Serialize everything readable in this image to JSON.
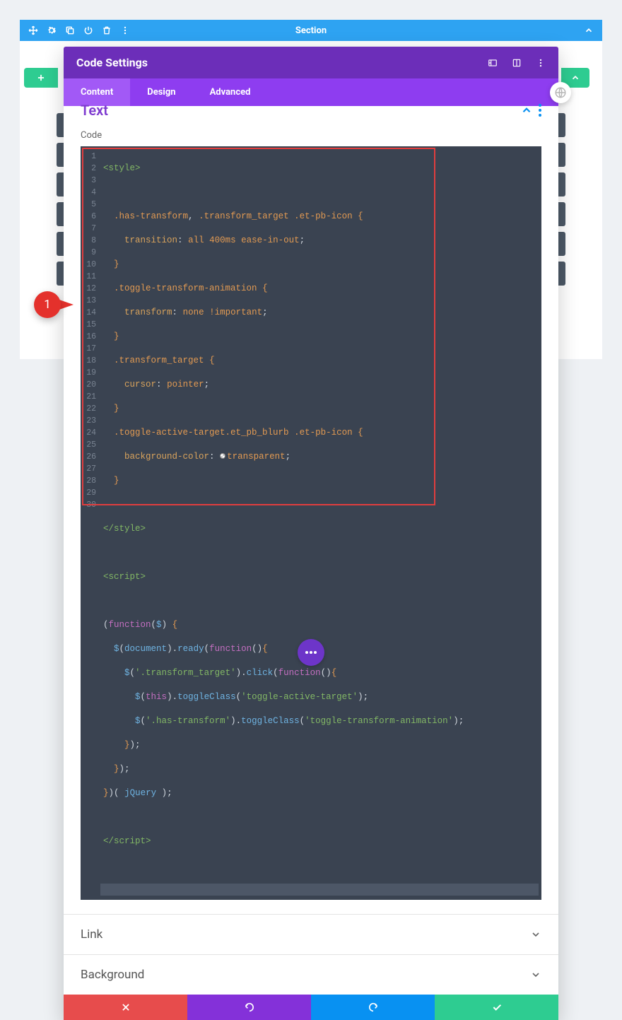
{
  "section": {
    "title": "Section"
  },
  "modal": {
    "title": "Code Settings",
    "tabs": {
      "content": "Content",
      "design": "Design",
      "advanced": "Advanced"
    },
    "text_section": "Text",
    "code_label": "Code",
    "accordion": {
      "link": "Link",
      "background": "Background"
    }
  },
  "annotation": {
    "number": "1"
  },
  "code": {
    "lines": [
      "<style>",
      "",
      "  .has-transform, .transform_target .et-pb-icon {",
      "    transition: all 400ms ease-in-out;",
      "  }",
      "  .toggle-transform-animation {",
      "    transform: none !important;",
      "  }",
      "  .transform_target {",
      "    cursor: pointer;",
      "  }",
      "  .toggle-active-target.et_pb_blurb .et-pb-icon {",
      "    background-color: transparent;",
      "  }",
      "",
      "</style>",
      "",
      "<script>",
      "",
      "(function($) {",
      "  $(document).ready(function(){",
      "    $('.transform_target').click(function(){",
      "      $(this).toggleClass('toggle-active-target');",
      "      $('.has-transform').toggleClass('toggle-transform-animation');",
      "    });",
      "  });",
      "})( jQuery );",
      "",
      "</script>",
      ""
    ]
  },
  "tokens": {
    "style_open": "<style>",
    "style_close": "</style>",
    "script_open": "<script>",
    "script_close": "</script>",
    "l3_sel": ".has-transform",
    "l3_sel2": ".transform_target",
    "l3_sel3": ".et-pb-icon",
    "l4_prop": "transition",
    "l4_all": "all",
    "l4_dur": "400ms",
    "l4_ease": "ease-in-out",
    "l6_sel": ".toggle-transform-animation",
    "l7_prop": "transform",
    "l7_val": "none",
    "l7_imp": "!important",
    "l9_sel": ".transform_target",
    "l10_prop": "cursor",
    "l10_val": "pointer",
    "l12_sel": ".toggle-active-target.et_pb_blurb",
    "l12_sel2": ".et-pb-icon",
    "l13_prop": "background-color",
    "l13_val": "transparent",
    "fn": "function",
    "dollar": "$",
    "doc": "document",
    "ready": "ready",
    "click": "click",
    "this": "this",
    "toggleClass": "toggleClass",
    "str1": "'.transform_target'",
    "str2": "'toggle-active-target'",
    "str3": "'.has-transform'",
    "str4": "'toggle-transform-animation'",
    "jquery": "jQuery",
    "brace_open": "{",
    "brace_close": "}",
    "paren_open": "(",
    "paren_close": ")",
    "colon": ":",
    "semi": ";",
    "comma": ",",
    "dot": "."
  }
}
